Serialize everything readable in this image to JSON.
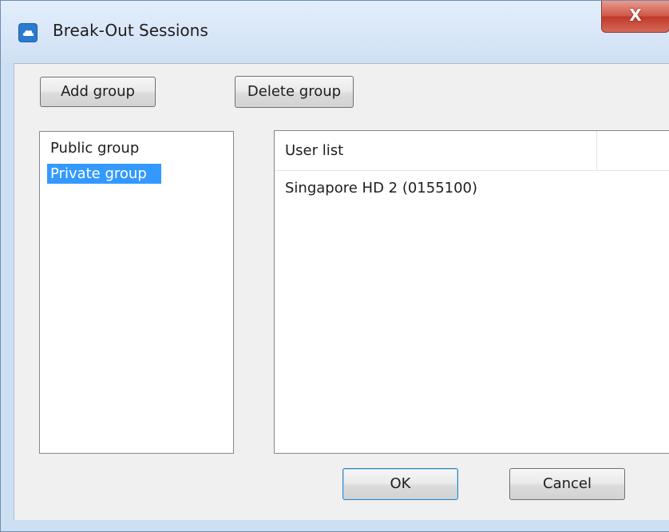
{
  "window": {
    "title": "Break-Out Sessions",
    "close_label": "X",
    "icon": "cloud-app-icon",
    "accent_color": "#2b7ad0",
    "close_color": "#c0392b"
  },
  "toolbar": {
    "add_group_label": "Add group",
    "delete_group_label": "Delete group"
  },
  "groups": {
    "items": [
      {
        "label": "Public group",
        "selected": false
      },
      {
        "label": "Private group",
        "selected": true
      }
    ],
    "selection_color": "#3399ff"
  },
  "users": {
    "header": "User list",
    "rows": [
      {
        "label": "Singapore HD 2 (0155100)"
      }
    ]
  },
  "footer": {
    "ok_label": "OK",
    "cancel_label": "Cancel"
  }
}
